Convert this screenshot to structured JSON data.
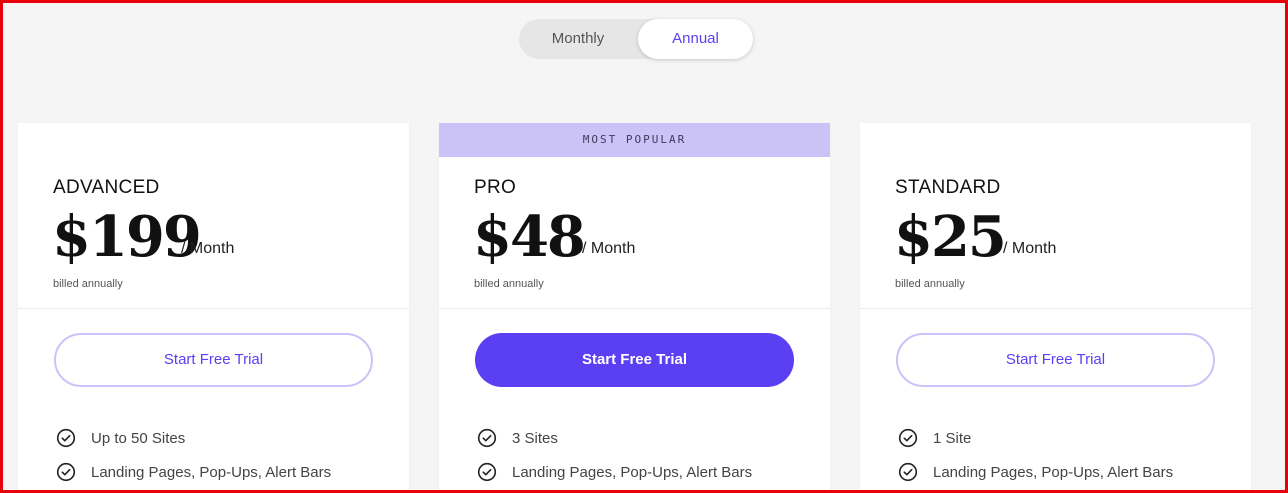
{
  "billing_toggle": {
    "monthly_label": "Monthly",
    "annual_label": "Annual",
    "selected": "Annual"
  },
  "colors": {
    "accent": "#5b3ff2",
    "badge_bg": "#cbc2f7",
    "page_bg": "#f5f5f5"
  },
  "plans": [
    {
      "name": "ADVANCED",
      "price": "$199",
      "period": "/ Month",
      "billing_note": "billed annually",
      "cta_label": "Start Free Trial",
      "features": [
        "Up to 50 Sites",
        "Landing Pages, Pop-Ups, Alert Bars"
      ]
    },
    {
      "badge": "MOST POPULAR",
      "name": "PRO",
      "price": "$48",
      "period": "/ Month",
      "billing_note": "billed annually",
      "cta_label": "Start Free Trial",
      "features": [
        "3 Sites",
        "Landing Pages, Pop-Ups, Alert Bars"
      ]
    },
    {
      "name": "STANDARD",
      "price": "$25",
      "period": "/ Month",
      "billing_note": "billed annually",
      "cta_label": "Start Free Trial",
      "features": [
        "1 Site",
        "Landing Pages, Pop-Ups, Alert Bars"
      ]
    }
  ],
  "feature_icon": "check-circle-icon"
}
